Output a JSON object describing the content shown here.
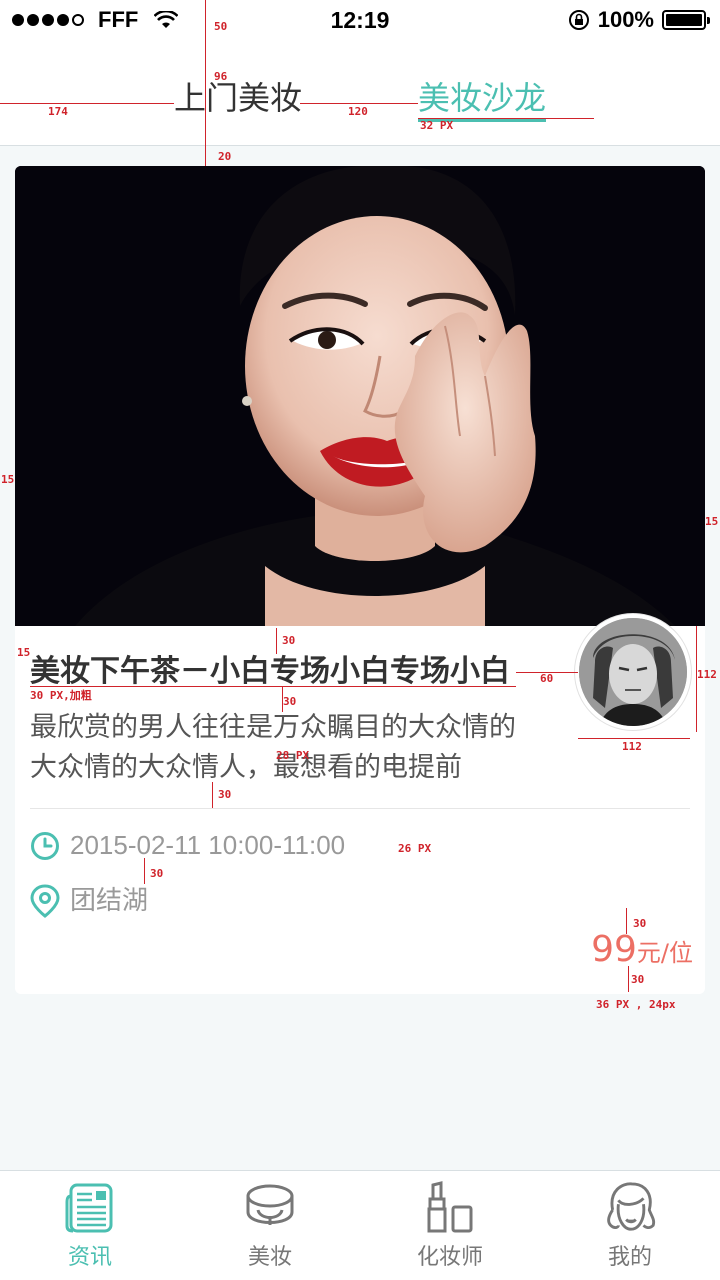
{
  "status_bar": {
    "carrier": "FFF",
    "time": "12:19",
    "battery": "100%",
    "signal_icon": "signal-dots-icon",
    "wifi_icon": "wifi-icon",
    "rotation_lock_icon": "rotation-lock-icon",
    "battery_icon": "battery-icon"
  },
  "header": {
    "tabs": [
      {
        "label": "上门美妆",
        "active": false
      },
      {
        "label": "美妆沙龙",
        "active": true
      }
    ]
  },
  "card": {
    "title": "美妆下午茶－小白专场小白专场小白",
    "description": "最欣赏的男人往往是万众瞩目的大众情的大众情的大众情人，最想看的电提前",
    "datetime": "2015-02-11 10:00-11:00",
    "location": "团结湖",
    "price_value": "99",
    "price_unit": "元/位",
    "clock_icon": "clock-icon",
    "location_icon": "location-pin-icon"
  },
  "annotations": {
    "a50": "50",
    "a96": "96",
    "a174": "174",
    "a120": "120",
    "a32px": "32 PX",
    "a20": "20",
    "a15a": "15",
    "a15b": "15",
    "a15c": "15",
    "a30a": "30",
    "a30px_bold": "30 PX,加粗",
    "a30b": "30",
    "a60": "60",
    "a112a": "112",
    "a112b": "112",
    "a28px": "28 PX",
    "a30c": "30",
    "a26px": "26 PX",
    "a30d": "30",
    "a30e": "30",
    "a30f": "30",
    "a36px": "36 PX , 24px"
  },
  "bottom_nav": {
    "items": [
      {
        "label": "资讯",
        "icon": "news-icon",
        "active": true
      },
      {
        "label": "美妆",
        "icon": "compact-powder-icon",
        "active": false
      },
      {
        "label": "化妆师",
        "icon": "lipstick-icon",
        "active": false
      },
      {
        "label": "我的",
        "icon": "profile-face-icon",
        "active": false
      }
    ]
  },
  "colors": {
    "accent": "#4bbfb1",
    "price": "#ec6f64",
    "annotation": "#d0232b",
    "background": "#f4f8f9"
  }
}
